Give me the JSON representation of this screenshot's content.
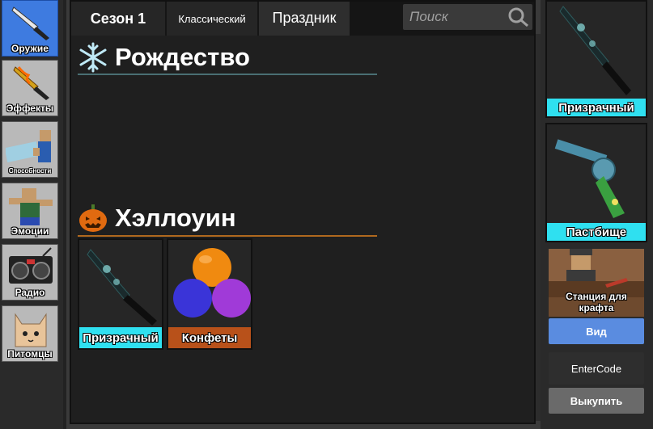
{
  "sidebar": {
    "items": [
      {
        "label": "Оружие",
        "icon": "knife-icon",
        "active": true
      },
      {
        "label": "Эффекты",
        "icon": "flame-knife-icon",
        "active": false
      },
      {
        "label": "Способности",
        "icon": "ability-icon",
        "active": false
      },
      {
        "label": "Эмоции",
        "icon": "emote-icon",
        "active": false
      },
      {
        "label": "Радио",
        "icon": "radio-icon",
        "active": false
      },
      {
        "label": "Питомцы",
        "icon": "pet-icon",
        "active": false
      }
    ]
  },
  "tabs": {
    "season": "Сезон 1",
    "classic": "Классический",
    "holiday": "Праздник"
  },
  "search": {
    "placeholder": "Поиск"
  },
  "sections": {
    "christmas": {
      "title": "Рождество",
      "icon": "snowflake-icon",
      "line_color": "#4a6f73"
    },
    "halloween": {
      "title": "Хэллоуин",
      "icon": "pumpkin-icon",
      "line_color": "#b0681e",
      "items": [
        {
          "label": "Призрачный",
          "rarity_color": "#2fe0f0",
          "icon": "ghost-knife-icon"
        },
        {
          "label": "Конфеты",
          "rarity_color": "#b8511a",
          "icon": "candy-icon"
        }
      ]
    }
  },
  "equipped": {
    "knife": {
      "label": "Призрачный",
      "rarity_color": "#2fe0f0"
    },
    "gun": {
      "label": "Пастбище",
      "rarity_color": "#2fe0f0"
    }
  },
  "craft": {
    "label": "Станция для крафта"
  },
  "buttons": {
    "view": "Вид",
    "enter_code": "EnterCode",
    "redeem": "Выкупить"
  },
  "colors": {
    "accent_blue": "#3e7be0",
    "view_button": "#5a8ce0",
    "legendary_cyan": "#2fe0f0",
    "candy_orange": "#b8511a"
  }
}
